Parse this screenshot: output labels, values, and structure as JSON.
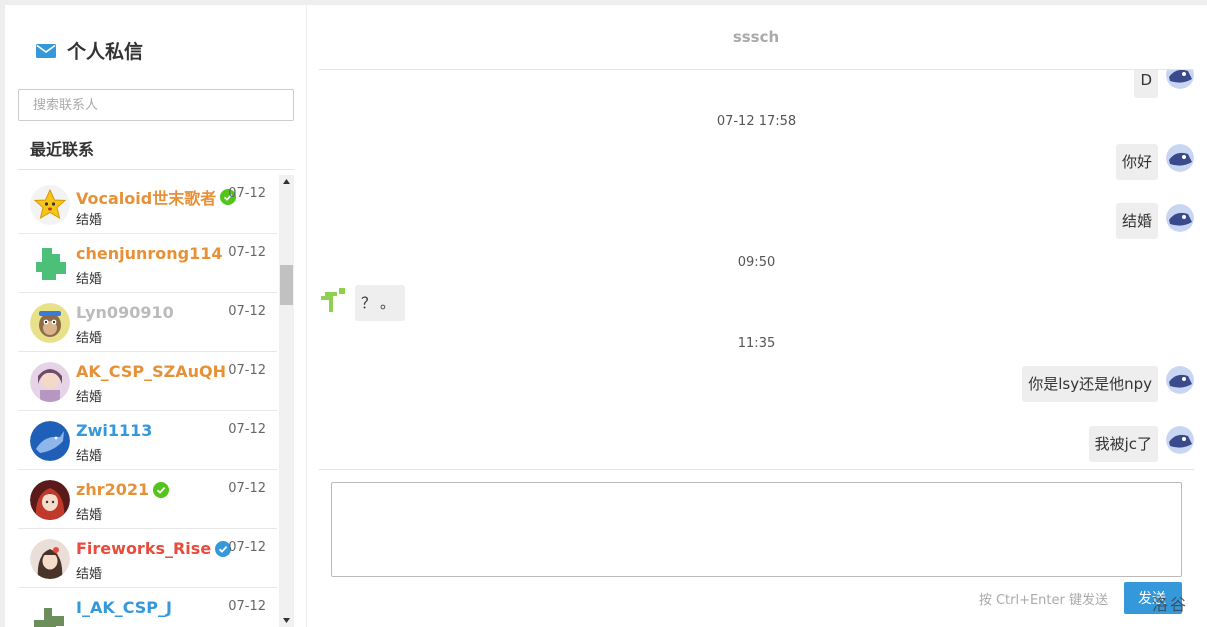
{
  "sidebar": {
    "title": "个人私信",
    "search_placeholder": "搜索联系人",
    "recent_label": "最近联系",
    "contacts": [
      {
        "name": "Vocaloid世末歌者",
        "name_color": "#e69138",
        "verified": "green",
        "last_message": "结婚",
        "date": "07-12"
      },
      {
        "name": "chenjunrong114",
        "name_color": "#e69138",
        "verified": "",
        "last_message": "结婚",
        "date": "07-12"
      },
      {
        "name": "Lyn090910",
        "name_color": "#bbbbbb",
        "verified": "",
        "last_message": "结婚",
        "date": "07-12"
      },
      {
        "name": "AK_CSP_SZAuQH",
        "name_color": "#e69138",
        "verified": "",
        "last_message": "结婚",
        "date": "07-12"
      },
      {
        "name": "Zwi1113",
        "name_color": "#3498db",
        "verified": "",
        "last_message": "结婚",
        "date": "07-12"
      },
      {
        "name": "zhr2021",
        "name_color": "#e69138",
        "verified": "green",
        "last_message": "结婚",
        "date": "07-12"
      },
      {
        "name": "Fireworks_Rise",
        "name_color": "#e74c3c",
        "verified": "blue",
        "last_message": "结婚",
        "date": "07-12"
      },
      {
        "name": "I_AK_CSP_J",
        "name_color": "#3498db",
        "verified": "",
        "last_message": "",
        "date": "07-12"
      }
    ]
  },
  "chat": {
    "title": "sssch",
    "messages": [
      {
        "type": "me",
        "text": "D"
      },
      {
        "type": "time",
        "text": "07-12 17:58"
      },
      {
        "type": "me",
        "text": "你好"
      },
      {
        "type": "me",
        "text": "结婚"
      },
      {
        "type": "time",
        "text": "09:50"
      },
      {
        "type": "other",
        "text": "？。"
      },
      {
        "type": "time",
        "text": "11:35"
      },
      {
        "type": "me",
        "text": "你是lsy还是他npy"
      },
      {
        "type": "me",
        "text": "我被jc了"
      }
    ],
    "send_hint": "按 Ctrl+Enter 键发送",
    "send_label": "发送",
    "watermark": "洛谷"
  },
  "colors": {
    "accent": "#3498db",
    "verified_green": "#52c41a",
    "verified_blue": "#3498db"
  }
}
